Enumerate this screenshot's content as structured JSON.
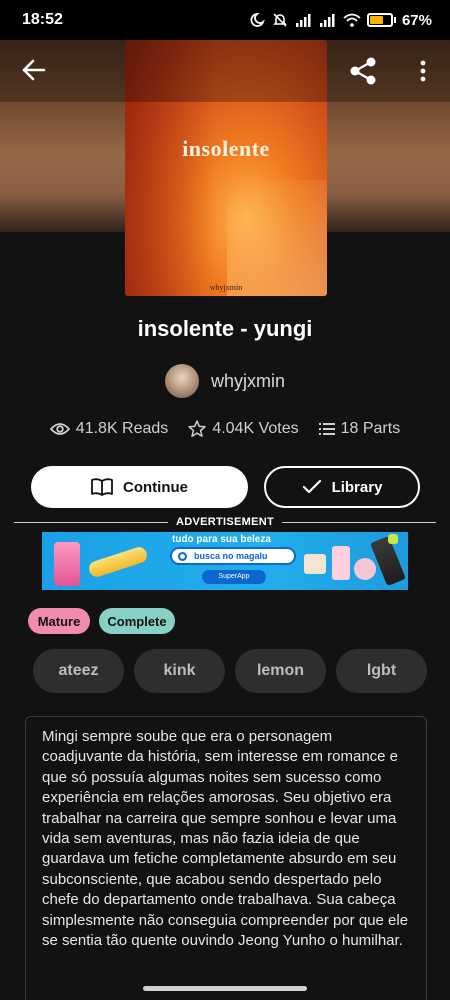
{
  "status_bar": {
    "time": "18:52",
    "battery_percent": "67%",
    "battery_level": 0.67,
    "icons": [
      "moon-icon",
      "bell-off-icon",
      "signal-icon",
      "signal-icon",
      "wifi-icon",
      "battery-icon"
    ]
  },
  "toolbar": {
    "back_icon": "arrow-left-icon",
    "share_icon": "share-icon",
    "more_icon": "more-vertical-icon"
  },
  "cover": {
    "title": "insolente",
    "author": "whyjxmin"
  },
  "story": {
    "title": "insolente - yungi",
    "author": "whyjxmin"
  },
  "stats": {
    "reads": "41.8K Reads",
    "votes": "4.04K Votes",
    "parts": "18 Parts"
  },
  "actions": {
    "continue_label": "Continue",
    "library_label": "Library"
  },
  "ad": {
    "label": "ADVERTISEMENT",
    "headline": "tudo para sua beleza",
    "search_text": "busca no magalu",
    "pill_text": "SuperApp"
  },
  "badges": {
    "mature": "Mature",
    "complete": "Complete"
  },
  "tags": [
    "ateez",
    "kink",
    "lemon",
    "lgbt"
  ],
  "description": "Mingi sempre soube que era o personagem coadjuvante da história, sem interesse em romance e que só possuía algumas noites sem sucesso como experiência em relações amorosas. Seu objetivo era trabalhar na carreira que sempre sonhou e levar uma vida sem aventuras, mas não fazia ideia de que guardava um fetiche completamente absurdo em seu subconsciente, que acabou sendo despertado pelo chefe do departamento onde trabalhava. Sua cabeça simplesmente não conseguia compreender por que ele se sentia tão quente ouvindo Jeong Yunho o humilhar.",
  "colors": {
    "background": "#121212",
    "mature_badge": "#f28bb0",
    "complete_badge": "#86d0c6",
    "tag_bg": "#2e2e2e",
    "battery": "#f5b400"
  }
}
